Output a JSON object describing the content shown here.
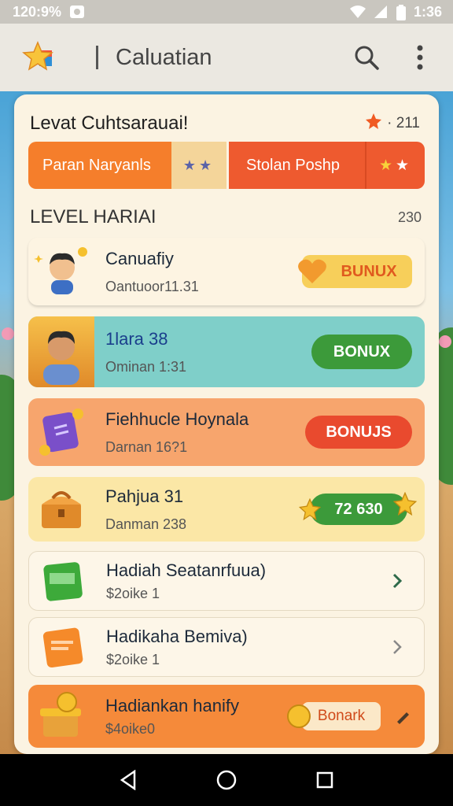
{
  "status_bar": {
    "left_text": "120:9%",
    "time": "1:36"
  },
  "app_bar": {
    "title": "Caluatian"
  },
  "card": {
    "title": "Levat Cuhtsarauai!",
    "score": "211",
    "tabs": [
      {
        "label": "Paran Naryanls",
        "stars": "★★"
      },
      {
        "label": "Stolan Poshp",
        "stars": "★★"
      }
    ]
  },
  "section": {
    "title": "LEVEL HARIAI",
    "count": "230"
  },
  "rows": [
    {
      "name": "Canuafiy",
      "sub": "Oantuoor11.31",
      "action": "BUNUX"
    },
    {
      "name": "1lara 38",
      "sub": "Ominan 1:31",
      "action": "BONUX"
    },
    {
      "name": "Fiehhucle Hoynala",
      "sub": "Darnan 16?1",
      "action": "BONUJS"
    },
    {
      "name": "Pahjua 31",
      "sub": "Danman 238",
      "action": "72 630"
    },
    {
      "name": "Hadiah Seatanrfuua)",
      "sub": "$2oike 1"
    },
    {
      "name": "Hadikaha Bemiva)",
      "sub": "$2oike 1"
    },
    {
      "name": "Hadiankan hanify",
      "sub": "$4oike0",
      "action": "Bonark"
    }
  ],
  "colors": {
    "accent_orange": "#f57e2b",
    "accent_red": "#ee5a2f",
    "bonus_green": "#3c9a3a",
    "bonus_red": "#e94a2e",
    "gold": "#f5c02e"
  },
  "icons": {
    "app_logo": "star-logo-icon",
    "search": "search-icon",
    "menu": "more-vert-icon"
  }
}
